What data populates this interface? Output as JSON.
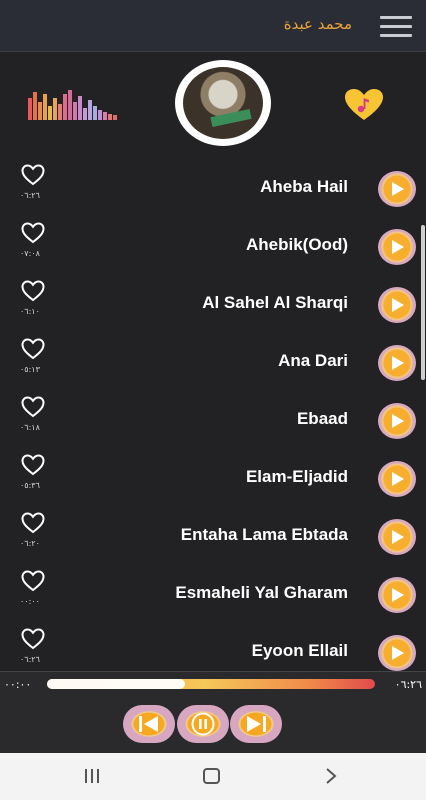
{
  "app": {
    "title": "محمد عبدة"
  },
  "songs": [
    {
      "title": "Aheba Hail",
      "duration": "٠٦:٢٦"
    },
    {
      "title": "Ahebik(Ood)",
      "duration": "٠٧:٠٨"
    },
    {
      "title": "Al Sahel Al Sharqi",
      "duration": "٠٦:١٠"
    },
    {
      "title": "Ana Dari",
      "duration": "٠٥:١٣"
    },
    {
      "title": "Ebaad",
      "duration": "٠٦:١٨"
    },
    {
      "title": "Elam-Eljadid",
      "duration": "٠٥:٣٦"
    },
    {
      "title": "Entaha Lama Ebtada",
      "duration": "٠٦:٢٠"
    },
    {
      "title": "Esmaheli Yal Gharam",
      "duration": "٠٠:٠٠"
    },
    {
      "title": "Eyoon Ellail",
      "duration": "٠٦:٢٦"
    }
  ],
  "player": {
    "current_time": "٠٠:٠٠",
    "total_time": "٠٦:٢٦",
    "progress_fraction": 0.42
  },
  "colors": {
    "accent": "#f5a623",
    "background": "#222224",
    "appbar": "#2a2d35",
    "title_text": "#e8a43a"
  },
  "icons": {
    "menu": "hamburger-menu-icon",
    "equalizer": "equalizer-icon",
    "favorite": "heart-music-note-icon",
    "like": "heart-outline-icon",
    "play": "play-icon",
    "previous": "skip-previous-icon",
    "pause": "pause-icon",
    "next": "skip-next-icon"
  }
}
